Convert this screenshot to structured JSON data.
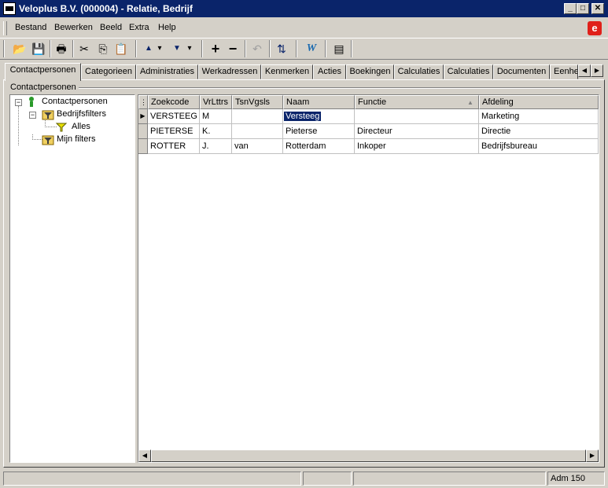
{
  "window": {
    "title": "Veloplus B.V. (000004) - Relatie, Bedrijf",
    "minimize_glyph": "_",
    "maximize_glyph": "□",
    "close_glyph": "✕"
  },
  "menu": [
    {
      "label": "Bestand"
    },
    {
      "label": "Bewerken"
    },
    {
      "label": "Beeld"
    },
    {
      "label": "Extra"
    },
    {
      "label": "Help"
    }
  ],
  "brand_logo": {
    "glyph": "e",
    "color": "#e0201a"
  },
  "toolbar": {
    "icons": [
      "open-folder-icon",
      "save-icon",
      "print-icon",
      "cut-icon",
      "copy-icon",
      "paste-icon",
      "arrow-up-icon",
      "dropdown-icon",
      "arrow-down-icon",
      "dropdown-icon",
      "add-icon",
      "remove-icon",
      "undo-icon",
      "refresh-icon",
      "word-icon",
      "layout-icon"
    ],
    "glyphs": {
      "open": "📂",
      "save": "💾",
      "print": "🖶",
      "cut": "✂",
      "copy": "⎘",
      "paste": "📋",
      "up": "▲",
      "dd": "▾",
      "down": "▼",
      "add": "+",
      "remove": "−",
      "undo": "↶",
      "refresh": "⇅",
      "word": "W",
      "layout": "▤"
    }
  },
  "tabs": [
    {
      "label": "Contactpersonen",
      "active": true
    },
    {
      "label": "Categorieen"
    },
    {
      "label": "Administraties"
    },
    {
      "label": "Werkadressen"
    },
    {
      "label": "Kenmerken"
    },
    {
      "label": "Acties"
    },
    {
      "label": "Boekingen"
    },
    {
      "label": "Calculaties"
    },
    {
      "label": "Calculaties"
    },
    {
      "label": "Documenten"
    },
    {
      "label": "Eenhe"
    }
  ],
  "tab_scroll": {
    "left": "◀",
    "right": "▶"
  },
  "group_label": "Contactpersonen",
  "tree": {
    "root": "Contactpersonen",
    "node_filters": "Bedrijfsfilters",
    "node_all": "Alles",
    "node_my": "Mijn filters",
    "expander": "−"
  },
  "grid": {
    "columns": [
      "Zoekcode",
      "VrLttrs",
      "TsnVgsls",
      "Naam",
      "Functie",
      "Afdeling"
    ],
    "sort_indicator": "▲",
    "row_marker": "▶",
    "rows": [
      [
        "VERSTEEG",
        "M",
        "",
        "Versteeg",
        "",
        "Marketing"
      ],
      [
        "PIETERSE",
        "K.",
        "",
        "Pieterse",
        "Directeur",
        "Directie"
      ],
      [
        "ROTTER",
        "J.",
        "van",
        "Rotterdam",
        "Inkoper",
        "Bedrijfsbureau"
      ]
    ]
  },
  "hscroll": {
    "left": "◀",
    "right": "▶"
  },
  "status": {
    "adm": "Adm 150"
  },
  "colors": {
    "titlebar": "#0a246a",
    "selection": "#0a246a",
    "face": "#d4d0c8"
  }
}
